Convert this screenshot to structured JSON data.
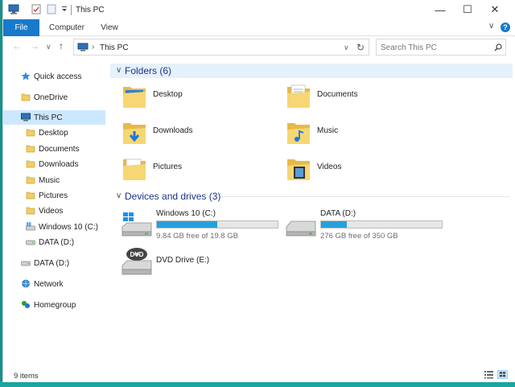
{
  "window": {
    "title": "This PC",
    "controls": {
      "minimize": "—",
      "maximize": "☐",
      "close": "✕"
    }
  },
  "ribbon": {
    "tabs": [
      {
        "label": "File"
      },
      {
        "label": "Computer"
      },
      {
        "label": "View"
      }
    ],
    "expand_glyph": "∨",
    "help_glyph": "?"
  },
  "navigation": {
    "back_glyph": "←",
    "forward_glyph": "→",
    "up_glyph": "↑",
    "dropdown_glyph": "∨",
    "refresh_glyph": "↻",
    "address": {
      "location": "This PC"
    },
    "search": {
      "placeholder": "Search This PC"
    }
  },
  "sidebar": {
    "items": [
      {
        "label": "Quick access",
        "icon": "star-icon"
      },
      {
        "label": "OneDrive",
        "icon": "onedrive-icon"
      },
      {
        "label": "This PC",
        "icon": "computer-icon",
        "selected": true
      },
      {
        "label": "Desktop",
        "icon": "folder-icon"
      },
      {
        "label": "Documents",
        "icon": "folder-icon"
      },
      {
        "label": "Downloads",
        "icon": "folder-icon"
      },
      {
        "label": "Music",
        "icon": "folder-icon"
      },
      {
        "label": "Pictures",
        "icon": "folder-icon"
      },
      {
        "label": "Videos",
        "icon": "folder-icon"
      },
      {
        "label": "Windows 10 (C:)",
        "icon": "windows-drive-icon"
      },
      {
        "label": "DATA (D:)",
        "icon": "drive-icon"
      },
      {
        "label": "DATA (D:)",
        "icon": "drive-icon"
      },
      {
        "label": "Network",
        "icon": "network-icon"
      },
      {
        "label": "Homegroup",
        "icon": "homegroup-icon"
      }
    ]
  },
  "content": {
    "folders_group": {
      "label": "Folders (6)",
      "items": [
        {
          "label": "Desktop",
          "icon": "desktop-folder-icon"
        },
        {
          "label": "Documents",
          "icon": "documents-folder-icon"
        },
        {
          "label": "Downloads",
          "icon": "downloads-folder-icon"
        },
        {
          "label": "Music",
          "icon": "music-folder-icon"
        },
        {
          "label": "Pictures",
          "icon": "pictures-folder-icon"
        },
        {
          "label": "Videos",
          "icon": "videos-folder-icon"
        }
      ]
    },
    "drives_group": {
      "label": "Devices and drives (3)",
      "items": [
        {
          "label": "Windows 10 (C:)",
          "free_text": "9.84 GB free of 19.8 GB",
          "used_fraction": 0.5,
          "icon": "windows-drive-icon"
        },
        {
          "label": "DATA (D:)",
          "free_text": "276 GB free of 350 GB",
          "used_fraction": 0.21,
          "icon": "hard-drive-icon"
        },
        {
          "label": "DVD Drive (E:)",
          "icon": "dvd-drive-icon"
        }
      ]
    }
  },
  "status": {
    "item_count": "9 items"
  },
  "colors": {
    "accent": "#1979ca",
    "selection": "#cce8ff",
    "group_header": "#1e3287",
    "drive_bar": "#26a0da",
    "folder": "#f2cd63",
    "desktop_bg": "#1ca7a7"
  }
}
